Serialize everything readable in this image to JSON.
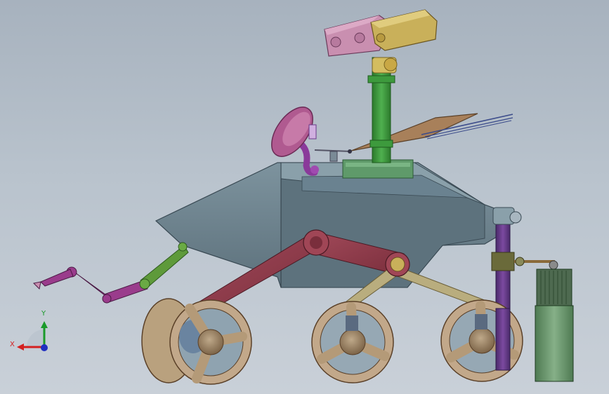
{
  "view": {
    "background_top": "#a7b2be",
    "background_bottom": "#c9d0d8"
  },
  "triad": {
    "x_label": "X",
    "y_label": "Y",
    "x_color": "#d42020",
    "y_color": "#1a9a2a",
    "z_color": "#2030c0"
  },
  "parts": {
    "body_color": "#6f8590",
    "rocker_color": "#8e3a4a",
    "bogie_color": "#b9ad7e",
    "wheel_color": "#c2a88a",
    "mast_color": "#3d9a3d",
    "camera_left_color": "#c98fb0",
    "camera_right_color": "#c9b05a",
    "dish_color": "#b05a90",
    "arm_color": "#9a3c8c",
    "arm_joint_color": "#5e9a3a",
    "leg_color": "#6a3a8a",
    "cylinder_color": "#6f9a70",
    "solar_color": "#a8805a"
  }
}
